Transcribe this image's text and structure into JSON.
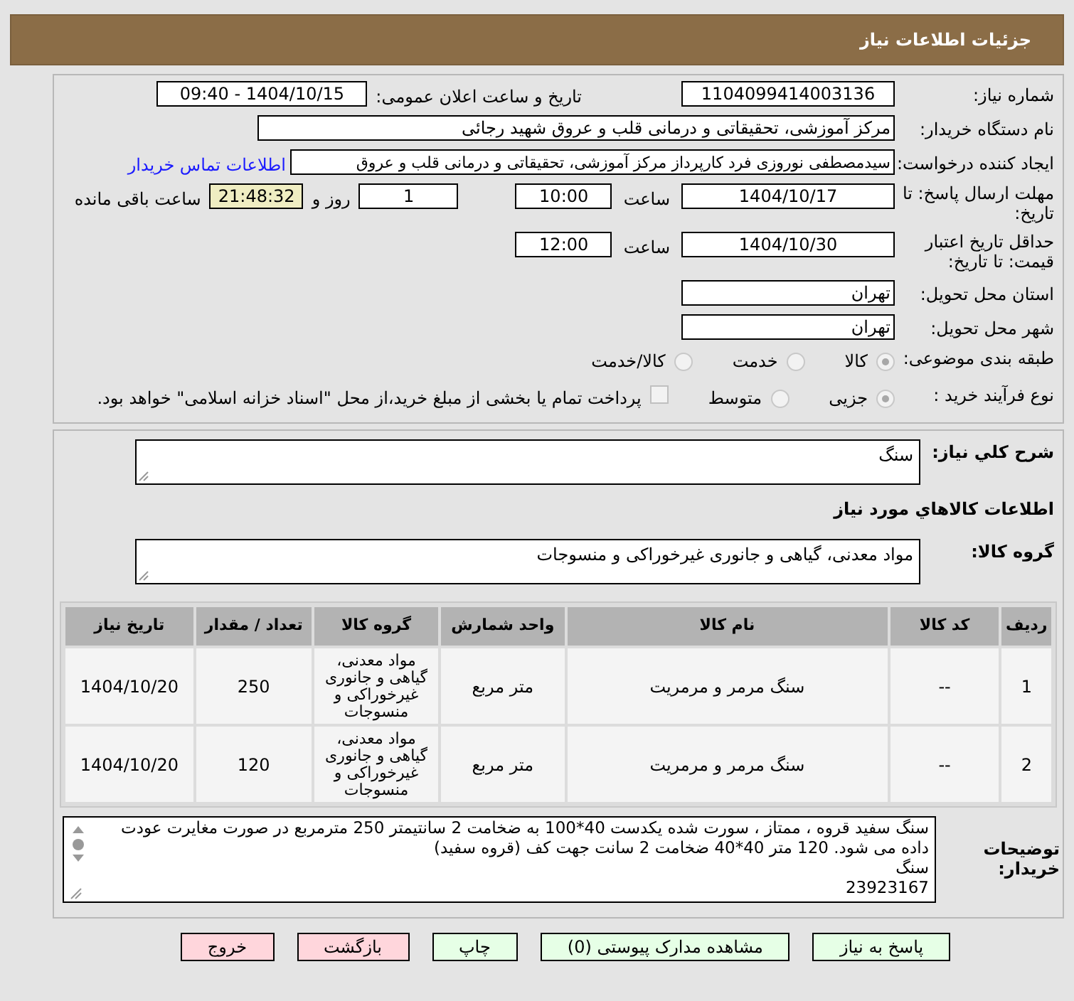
{
  "title": "جزئیات اطلاعات نیاز",
  "need_number": {
    "label": "شماره نیاز:",
    "value": "1104099414003136"
  },
  "announce": {
    "label": "تاریخ و ساعت اعلان عمومی:",
    "value": "1404/10/15 - 09:40"
  },
  "buyer": {
    "label": "نام دستگاه خریدار:",
    "value": "مرکز آموزشی، تحقیقاتی و درمانی قلب و عروق شهید رجائی"
  },
  "creator": {
    "label": "ایجاد کننده درخواست:",
    "value": "سیدمصطفی نوروزی فرد کارپرداز مرکز آموزشی، تحقیقاتی و درمانی قلب و عروق",
    "link": "اطلاعات تماس خریدار"
  },
  "deadline": {
    "label": "مهلت ارسال پاسخ: تا تاریخ:",
    "date": "1404/10/17",
    "time_label": "ساعت",
    "time": "10:00",
    "days": "1",
    "days_label": "روز و",
    "remaining": "21:48:32",
    "remaining_label": "ساعت باقی مانده"
  },
  "validity": {
    "label": "حداقل تاریخ اعتبار قیمت: تا تاریخ:",
    "date": "1404/10/30",
    "time_label": "ساعت",
    "time": "12:00"
  },
  "province": {
    "label": "استان محل تحویل:",
    "value": "تهران"
  },
  "city": {
    "label": "شهر محل تحویل:",
    "value": "تهران"
  },
  "category": {
    "label": "طبقه بندی موضوعی:",
    "options": [
      {
        "label": "کالا",
        "selected": true
      },
      {
        "label": "خدمت",
        "selected": false
      },
      {
        "label": "کالا/خدمت",
        "selected": false
      }
    ]
  },
  "process": {
    "label": "نوع فرآیند خرید :",
    "options": [
      {
        "label": "جزیی",
        "selected": true
      },
      {
        "label": "متوسط",
        "selected": false
      }
    ],
    "payment": {
      "checked": false,
      "text": "پرداخت تمام یا بخشی از مبلغ خرید،از محل \"اسناد خزانه اسلامی\" خواهد بود."
    }
  },
  "summary": {
    "label": "شرح کلي نياز:",
    "value": "سنگ"
  },
  "goods_heading": "اطلاعات کالاهاي مورد نياز",
  "goods_group": {
    "label": "گروه کالا:",
    "value": "مواد معدنی، گیاهی و جانوری غیرخوراکی و منسوجات"
  },
  "table": {
    "columns": [
      "ردیف",
      "کد کالا",
      "نام کالا",
      "واحد شمارش",
      "گروه کالا",
      "تعداد / مقدار",
      "تاریخ نیاز"
    ],
    "rows": [
      [
        "1",
        "--",
        "سنگ مرمر و مرمریت",
        "متر مربع",
        "مواد معدنی، گیاهی و جانوری غیرخوراکی و منسوجات",
        "250",
        "1404/10/20"
      ],
      [
        "2",
        "--",
        "سنگ مرمر و مرمریت",
        "متر مربع",
        "مواد معدنی، گیاهی و جانوری غیرخوراکی و منسوجات",
        "120",
        "1404/10/20"
      ]
    ]
  },
  "buyer_notes": {
    "label": "توضیحات خریدار:",
    "value": "سنگ سفید قروه ، ممتاز ، سورت شده یکدست 40*100 به ضخامت 2 سانتیمتر 250 مترمربع در صورت مغایرت عودت داده می شود. 120 متر 40*40 ضخامت 2 سانت جهت کف (قروه سفید)\nسنگ\n23923167"
  },
  "buttons": [
    {
      "label": "پاسخ به نیاز",
      "kind": "primary"
    },
    {
      "label": "مشاهده مدارک پیوستی (0)",
      "kind": "primary"
    },
    {
      "label": "چاپ",
      "kind": "primary"
    },
    {
      "label": "بازگشت",
      "kind": "danger"
    },
    {
      "label": "خروج",
      "kind": "danger"
    }
  ]
}
